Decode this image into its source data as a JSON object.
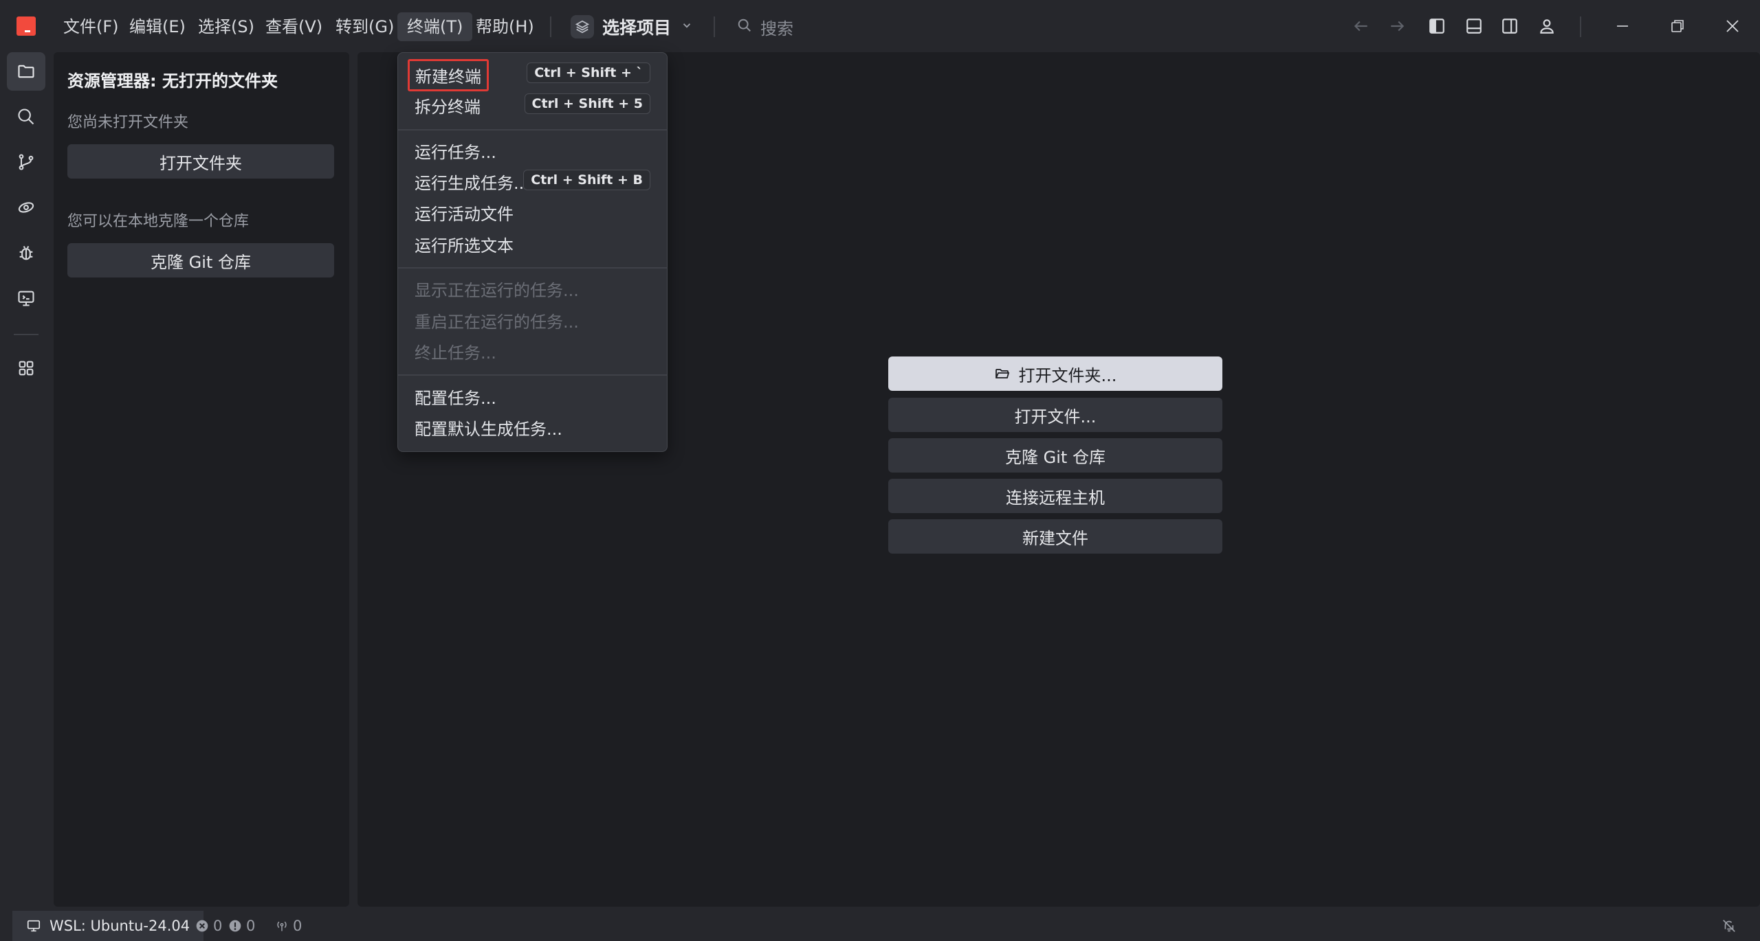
{
  "menubar": {
    "items": [
      "文件(F)",
      "编辑(E)",
      "选择(S)",
      "查看(V)",
      "转到(G)",
      "终端(T)",
      "帮助(H)"
    ],
    "active": "终端(T)"
  },
  "project": {
    "label": "选择项目"
  },
  "search": {
    "placeholder": "搜索"
  },
  "sidebar": {
    "title": "资源管理器: 无打开的文件夹",
    "no_folder_text": "您尚未打开文件夹",
    "open_folder_button": "打开文件夹",
    "clone_text": "您可以在本地克隆一个仓库",
    "clone_button": "克隆 Git 仓库"
  },
  "welcome": {
    "actions": [
      "打开文件夹...",
      "打开文件...",
      "克隆 Git 仓库",
      "连接远程主机",
      "新建文件"
    ]
  },
  "terminal_menu": {
    "items": [
      {
        "label": "新建终端",
        "shortcut": "Ctrl + Shift + `",
        "highlighted": true
      },
      {
        "label": "拆分终端",
        "shortcut": "Ctrl + Shift + 5"
      },
      {
        "label": "运行任务..."
      },
      {
        "label": "运行生成任务...",
        "shortcut": "Ctrl + Shift + B"
      },
      {
        "label": "运行活动文件"
      },
      {
        "label": "运行所选文本"
      },
      {
        "label": "显示正在运行的任务...",
        "disabled": true
      },
      {
        "label": "重启正在运行的任务...",
        "disabled": true
      },
      {
        "label": "终止任务...",
        "disabled": true
      },
      {
        "label": "配置任务..."
      },
      {
        "label": "配置默认生成任务..."
      }
    ]
  },
  "statusbar": {
    "remote": "WSL: Ubuntu-24.04",
    "errors": "0",
    "warnings": "0",
    "ports": "0"
  },
  "colors": {
    "accent_logo": "#f24a3d",
    "highlight_border": "#e03a35",
    "background": "#26272c",
    "panel": "#1d1e22"
  }
}
